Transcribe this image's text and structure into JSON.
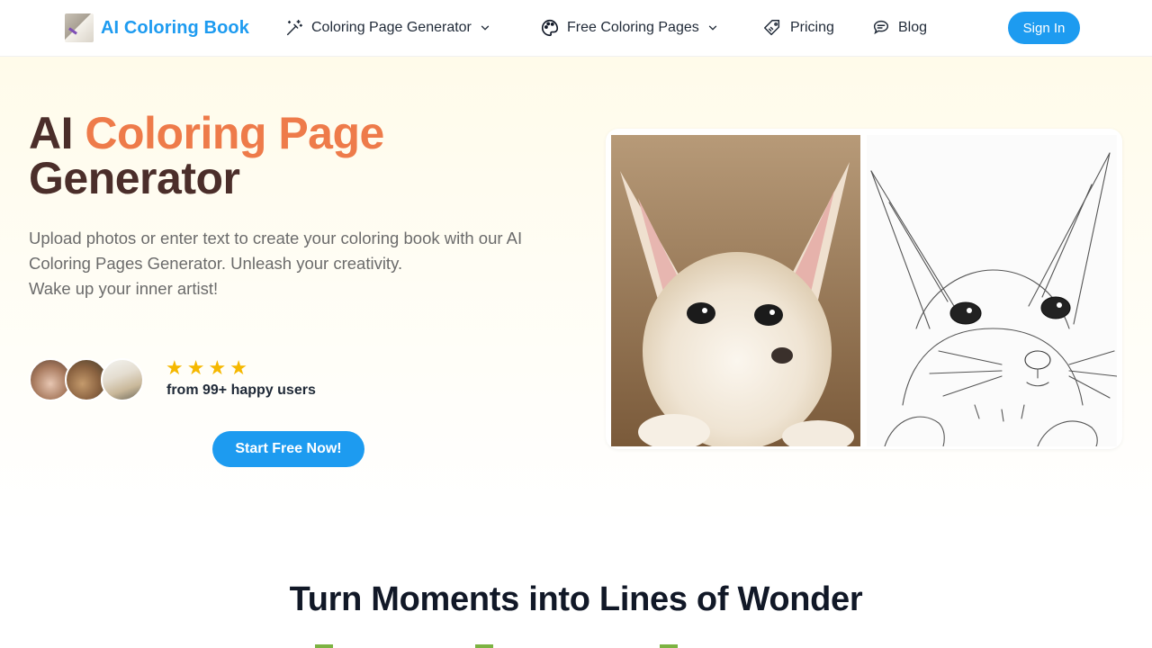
{
  "header": {
    "brand": "AI Coloring Book",
    "nav": {
      "generator": "Coloring Page Generator",
      "free_pages": "Free Coloring Pages",
      "pricing": "Pricing",
      "blog": "Blog"
    },
    "sign_in": "Sign In",
    "colors": {
      "brand": "#1d9bf0",
      "primary_button": "#1d9bf0"
    }
  },
  "hero": {
    "title_prefix": "AI ",
    "title_accent": "Coloring Page",
    "title_suffix": "Generator",
    "description_line1": "Upload photos or enter text to create your coloring book with our AI Coloring Pages Generator. Unleash your creativity.",
    "description_line2": "Wake up your inner artist!",
    "rating": {
      "stars": 4,
      "label": "from 99+ happy users"
    },
    "cta": "Start Free Now!",
    "colors": {
      "title": "#4b2e2a",
      "accent": "#ee7b4a"
    }
  },
  "section": {
    "title": "Turn Moments into Lines of Wonder"
  }
}
